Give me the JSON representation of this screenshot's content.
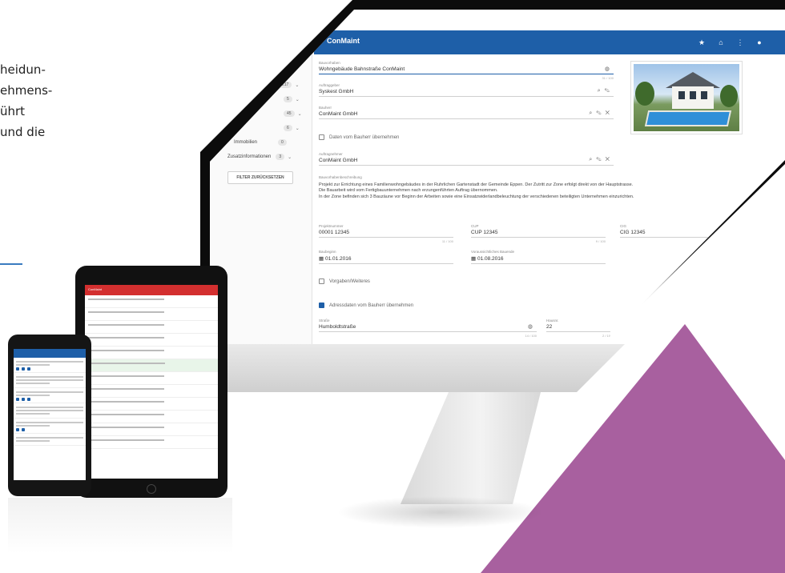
{
  "marketing": {
    "lines": [
      "heidun-",
      "ehmens-",
      "ührt",
      "und die"
    ]
  },
  "desktop_app": {
    "title": "ConMaint",
    "sidebar": {
      "rows": [
        {
          "label": "",
          "badge": "217"
        },
        {
          "label": "",
          "badge": "5"
        },
        {
          "label": "",
          "badge": "45"
        },
        {
          "label": "",
          "badge": "6"
        },
        {
          "label": "Immobilien",
          "badge": "0"
        },
        {
          "label": "Zusatzinformationen",
          "badge": "3"
        }
      ],
      "reset_button": "FILTER ZURÜCKSETZEN"
    },
    "form": {
      "bauvorhaben": {
        "label": "Bauvorhaben",
        "value": "Wohngebäude Bahnstraße ConMaint",
        "counter": "31 / 100"
      },
      "auftraggeber": {
        "label": "Auftraggeber",
        "value": "Syskest GmbH"
      },
      "bauherr": {
        "label": "Bauherr",
        "value": "ConMaint GmbH"
      },
      "bauherr_checkbox": "Daten vom Bauherr übernehmen",
      "auftragnehmer": {
        "label": "Auftragnehmer",
        "value": "ConMaint GmbH"
      },
      "beschreibung": {
        "label": "Bauvorhabenbeschreibung",
        "lines": [
          "Projekt zur Errichtung eines Familienwohngebäudes in der Ruhrlichen Gartenstadt der Gemeinde Eppen. Der Zutritt zur Zone erfolgt direkt von der Hauptstrasse.",
          "Die Bauarbeit wird vom Fertigbauunternehmen nach erzungenführten Auftrag übernommen.",
          "In der Zone befinden sich 3 Bauzäune vor Beginn der Arbeiten sowie eine Einsatzwiderlandbeleuchtung der verschiedenen beteiligten Unternehmen einzurichten."
        ]
      },
      "projektnummer": {
        "label": "Projektnummer",
        "value": "00001 12345",
        "counter": "11 / 100"
      },
      "cup": {
        "label": "CUP",
        "value": "CUP 12345",
        "counter": "9 / 100"
      },
      "cig": {
        "label": "CIG",
        "value": "CIG 12345"
      },
      "baubeginn": {
        "label": "Baubeginn",
        "value": "01.01.2016"
      },
      "bauende": {
        "label": "Voraussichtliches Bauende",
        "value": "01.08.2016"
      },
      "vorgaben_checkbox": "Vorgaben/Weiteres",
      "baustelle_checkbox": "Adressdaten vom Bauherr übernehmen",
      "strasse": {
        "label": "Straße",
        "value": "Humboldtstraße",
        "counter": "14 / 100"
      },
      "hausnummer": {
        "label": "Hausnr.",
        "value": "22",
        "counter": "2 / 10"
      }
    }
  },
  "tablet": {
    "rows": [
      "",
      "",
      "",
      "",
      "",
      "",
      "",
      "",
      "",
      "",
      "",
      ""
    ]
  },
  "colors": {
    "app_blue": "#1e5fa8",
    "tablet_red": "#d32f2f",
    "accent_purple": "#a8609f",
    "rule_blue": "#3a7bc0"
  }
}
